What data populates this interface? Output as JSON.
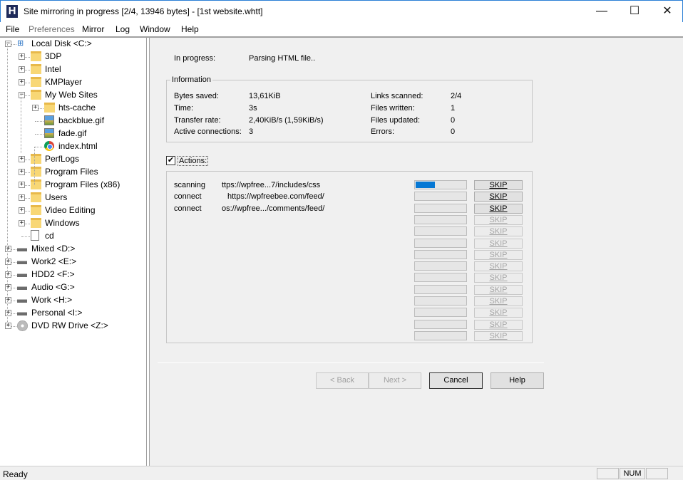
{
  "window": {
    "title": "Site mirroring in progress [2/4, 13946 bytes] - [1st website.whtt]",
    "app_icon": "H",
    "minimize_glyph": "—",
    "maximize_glyph": "☐",
    "close_glyph": "✕"
  },
  "menu": [
    "File",
    "Preferences",
    "Mirror",
    "Log",
    "Window",
    "Help"
  ],
  "tree": {
    "items": [
      {
        "label": "Local Disk <C:>",
        "expander": "−",
        "icon": "drive-c-icon"
      },
      {
        "label": "3DP",
        "expander": "+",
        "icon": "folder-icon"
      },
      {
        "label": "Intel",
        "expander": "+",
        "icon": "folder-icon"
      },
      {
        "label": "KMPlayer",
        "expander": "+",
        "icon": "folder-icon"
      },
      {
        "label": "My Web Sites",
        "expander": "−",
        "icon": "folder-icon"
      },
      {
        "label": "hts-cache",
        "expander": "+",
        "icon": "folder-icon"
      },
      {
        "label": "backblue.gif",
        "expander": "",
        "icon": "gif-file-icon"
      },
      {
        "label": "fade.gif",
        "expander": "",
        "icon": "gif-file-icon"
      },
      {
        "label": "index.html",
        "expander": "",
        "icon": "chrome-file-icon"
      },
      {
        "label": "PerfLogs",
        "expander": "+",
        "icon": "folder-icon"
      },
      {
        "label": "Program Files",
        "expander": "+",
        "icon": "folder-icon"
      },
      {
        "label": "Program Files (x86)",
        "expander": "+",
        "icon": "folder-icon"
      },
      {
        "label": "Users",
        "expander": "+",
        "icon": "folder-icon"
      },
      {
        "label": "Video Editing",
        "expander": "+",
        "icon": "folder-icon"
      },
      {
        "label": "Windows",
        "expander": "+",
        "icon": "folder-icon"
      },
      {
        "label": "cd",
        "expander": "",
        "icon": "blank-file-icon"
      },
      {
        "label": "Mixed <D:>",
        "expander": "+",
        "icon": "drive-icon"
      },
      {
        "label": "Work2 <E:>",
        "expander": "+",
        "icon": "drive-icon"
      },
      {
        "label": "HDD2 <F:>",
        "expander": "+",
        "icon": "drive-icon"
      },
      {
        "label": "Audio <G:>",
        "expander": "+",
        "icon": "drive-icon"
      },
      {
        "label": "Work <H:>",
        "expander": "+",
        "icon": "drive-icon"
      },
      {
        "label": "Personal <I:>",
        "expander": "+",
        "icon": "drive-icon"
      },
      {
        "label": "DVD RW Drive <Z:>",
        "expander": "+",
        "icon": "dvd-drive-icon"
      }
    ]
  },
  "progress": {
    "in_progress_label": "In progress:",
    "in_progress_value": "Parsing HTML file..",
    "info_title": "Information",
    "stats_left": [
      {
        "label": "Bytes saved:",
        "value": "13,61KiB"
      },
      {
        "label": "Time:",
        "value": "3s"
      },
      {
        "label": "Transfer rate:",
        "value": "2,40KiB/s (1,59KiB/s)"
      },
      {
        "label": "Active connections:",
        "value": "3"
      }
    ],
    "stats_right": [
      {
        "label": "Links scanned:",
        "value": "2/4"
      },
      {
        "label": "Files written:",
        "value": "1"
      },
      {
        "label": "Files updated:",
        "value": "0"
      },
      {
        "label": "Errors:",
        "value": "0"
      }
    ],
    "actions_label": "Actions:",
    "actions_checked": "✔",
    "actions": [
      {
        "type": "scanning",
        "url": "ttps://wpfree...7/includes/css",
        "progress": 0.38
      },
      {
        "type": "connect",
        "url": "https://wpfreebee.com/feed/",
        "progress": 0
      },
      {
        "type": "connect",
        "url": "os://wpfree.../comments/feed/",
        "progress": 0
      }
    ],
    "skip_label": "SKIP",
    "slot_count": 14
  },
  "buttons": {
    "back": "< Back",
    "next": "Next >",
    "cancel": "Cancel",
    "help": "Help"
  },
  "status": {
    "text": "Ready",
    "num": "NUM"
  },
  "colors": {
    "progress_fill": "#0678d4",
    "title_border": "#2b7fd6"
  }
}
